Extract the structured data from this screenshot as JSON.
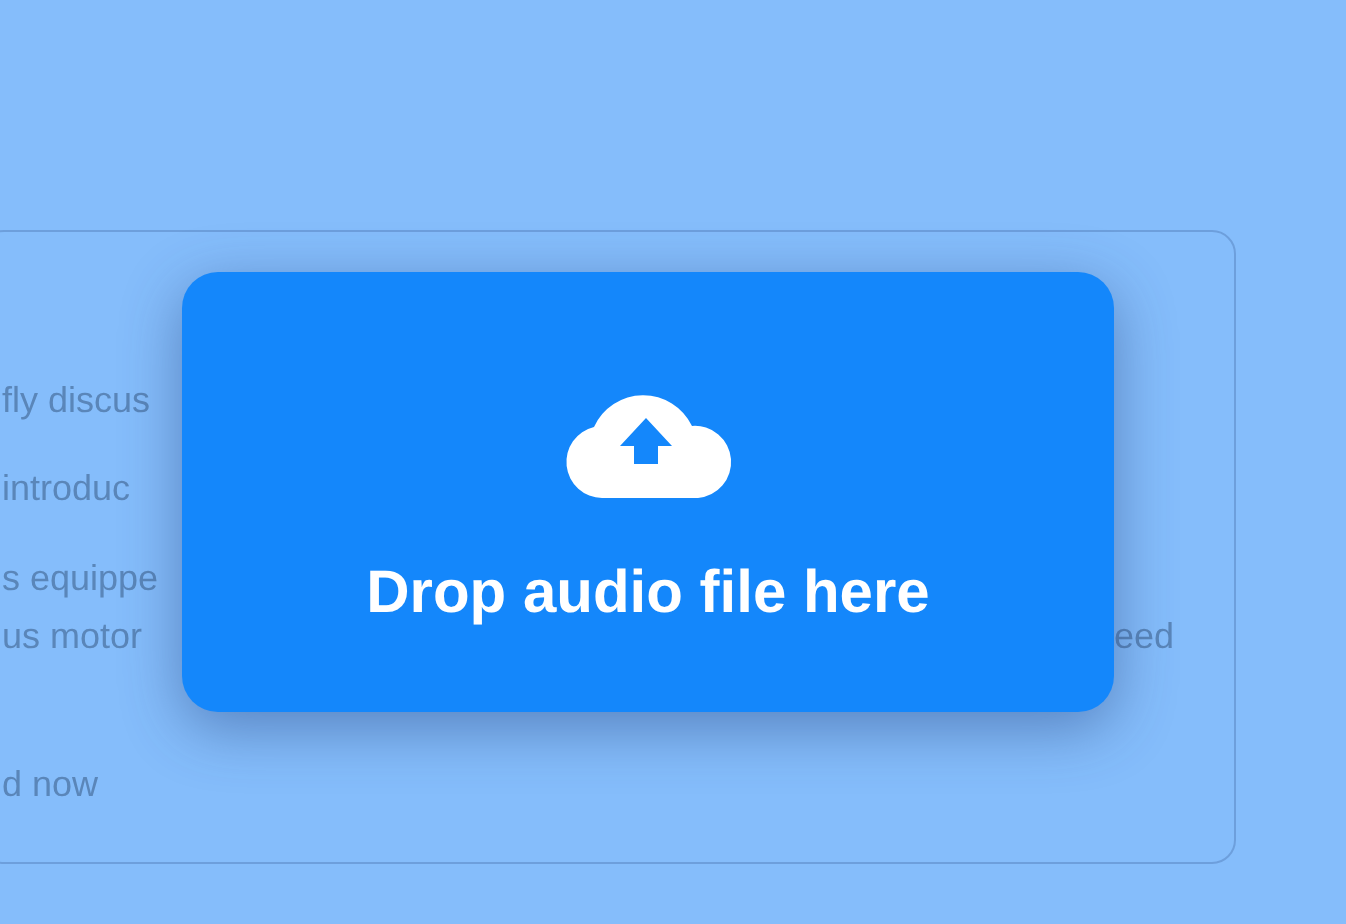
{
  "background_card": {
    "lines": [
      {
        "left": "fly discus"
      },
      {
        "left": "introduc"
      },
      {
        "left": "s equippe"
      },
      {
        "left": "us motor",
        "right": "eed"
      },
      {
        "left": "d now"
      }
    ]
  },
  "drop_overlay": {
    "title": "Drop audio file here"
  }
}
